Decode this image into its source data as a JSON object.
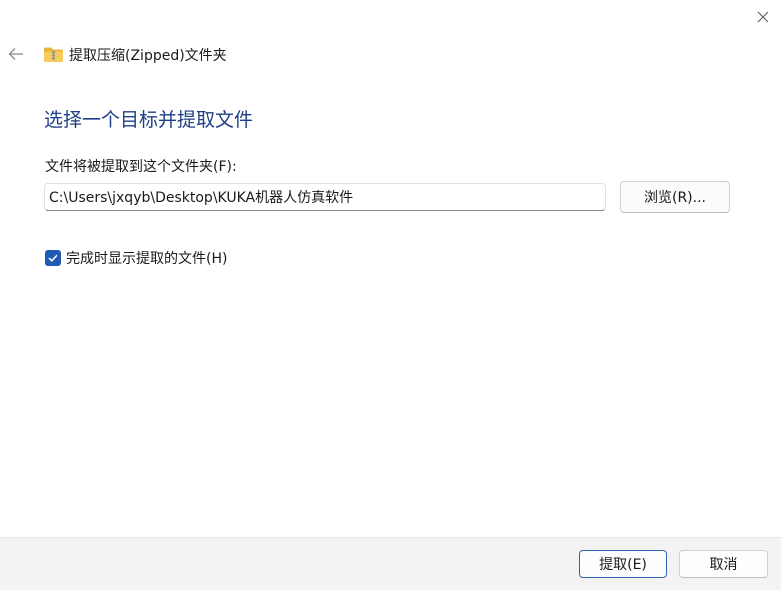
{
  "window": {
    "title": "提取压缩(Zipped)文件夹",
    "close_icon": "close-icon",
    "back_icon": "back-arrow-icon",
    "folder_icon": "zipped-folder-icon"
  },
  "main": {
    "heading": "选择一个目标并提取文件",
    "destination_label": "文件将被提取到这个文件夹(F):",
    "destination_value": "C:\\Users\\jxqyb\\Desktop\\KUKA机器人仿真软件",
    "browse_label": "浏览(R)...",
    "show_files_label": "完成时显示提取的文件(H)",
    "show_files_checked": true
  },
  "footer": {
    "extract_label": "提取(E)",
    "cancel_label": "取消"
  },
  "colors": {
    "heading": "#1f3f86",
    "accent": "#1f5ab4",
    "footer_bg": "#f3f3f3"
  }
}
